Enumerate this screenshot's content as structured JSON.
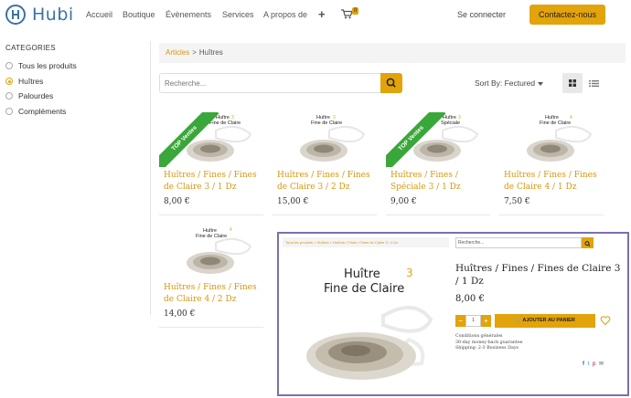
{
  "header": {
    "logo_text": "Hubi",
    "nav": [
      "Accueil",
      "Boutique",
      "Évènements",
      "Services",
      "A propos de"
    ],
    "cart_count": "0",
    "login": "Se connecter",
    "contact": "Contactez-nous"
  },
  "sidebar": {
    "title": "CATEGORIES",
    "items": [
      {
        "label": "Tous les produits",
        "selected": false
      },
      {
        "label": "Huîtres",
        "selected": true
      },
      {
        "label": "Palourdes",
        "selected": false
      },
      {
        "label": "Compléments",
        "selected": false
      }
    ]
  },
  "breadcrumb": {
    "link": "Articles",
    "separator": ">",
    "current": "Huîtres"
  },
  "search": {
    "placeholder": "Recherche..."
  },
  "sort": {
    "label": "Sort By: Fectured"
  },
  "ribbon_text": "TOP Ventes",
  "products": [
    {
      "name": "Huîtres / Fines / Fines de Claire 3 / 1 Dz",
      "price": "8,00 €",
      "img_line1": "Huître",
      "img_line2": "Fine de Claire",
      "img_num": "3",
      "ribbon": true
    },
    {
      "name": "Huîtres / Fines / Fines de Claire 3 / 2 Dz",
      "price": "15,00 €",
      "img_line1": "Huître",
      "img_line2": "Fine de Claire",
      "img_num": "3",
      "ribbon": false
    },
    {
      "name": "Huîtres / Fines / Spéciale 3 / 1 Dz",
      "price": "9,00 €",
      "img_line1": "Huître",
      "img_line2": "Spéciale",
      "img_num": "3",
      "ribbon": true
    },
    {
      "name": "Huîtres / Fines / Fines de Claire 4 / 1 Dz",
      "price": "7,50 €",
      "img_line1": "Huître",
      "img_line2": "Fine de Claire",
      "img_num": "4",
      "ribbon": false
    },
    {
      "name": "Huîtres / Fines / Fines de Claire 4 / 2 Dz",
      "price": "14,00 €",
      "img_line1": "Huître",
      "img_line2": "Fine de Claire",
      "img_num": "4",
      "ribbon": false
    }
  ],
  "detail": {
    "breadcrumb": "Tous les produits > Huîtres > Huîtres / Fines / Fines de Claire 3 / 1 Dz",
    "search_placeholder": "Recherche...",
    "img_line1": "Huître",
    "img_line2": "Fine de Claire",
    "img_num": "3",
    "name": "Huîtres / Fines / Fines de Claire 3 / 1 Dz",
    "price": "8,00 €",
    "qty": "1",
    "add_to_cart": "AJOUTER AU PANIER",
    "terms_line1": "Conditions générales",
    "terms_line2": "30-day money-back guarantee",
    "terms_line3": "Shipping: 2-3 Business Days"
  },
  "colors": {
    "accent": "#e2a30b",
    "link": "#d6960a",
    "ribbon": "#3aa73a",
    "overlay_border": "#7d6fab",
    "logo": "#3a73a6"
  }
}
